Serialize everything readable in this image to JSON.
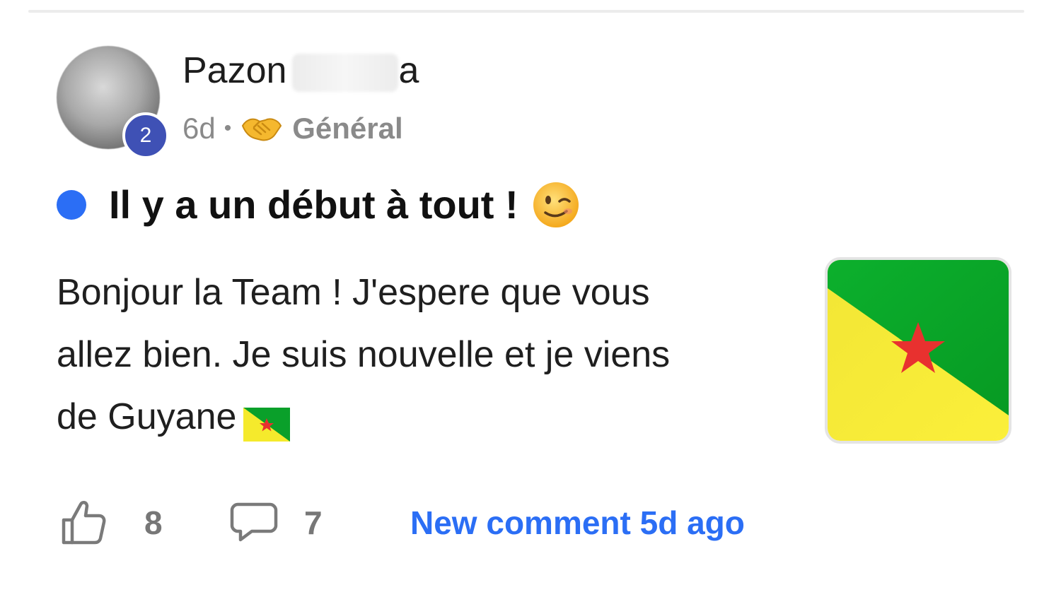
{
  "post": {
    "author": {
      "name_visible": "Pazon",
      "name_trailing_visible": "a",
      "level": "2"
    },
    "meta": {
      "age": "6d",
      "separator": "•",
      "category_icon": "handshake-icon",
      "category": "Général"
    },
    "title": "Il y a un début à tout !",
    "title_emoji": "wink-icon",
    "unread": true,
    "body_lines": [
      "Bonjour la Team ! J'espere que vous",
      "allez bien. Je suis nouvelle et je viens",
      "de Guyane"
    ],
    "body_emoji": "french-guiana-flag-icon",
    "thumbnail": "french-guiana-flag-image",
    "footer": {
      "like_icon": "thumbs-up-icon",
      "likes": "8",
      "comment_icon": "comment-bubble-icon",
      "comments": "7",
      "new_comment": "New comment 5d ago"
    },
    "colors": {
      "accent": "#2b6ef5",
      "badge": "#3f51b5",
      "muted": "#8a8a8a",
      "flag_green": "#0aa02a",
      "flag_yellow": "#f5ea2c",
      "flag_star": "#e8312f"
    }
  }
}
